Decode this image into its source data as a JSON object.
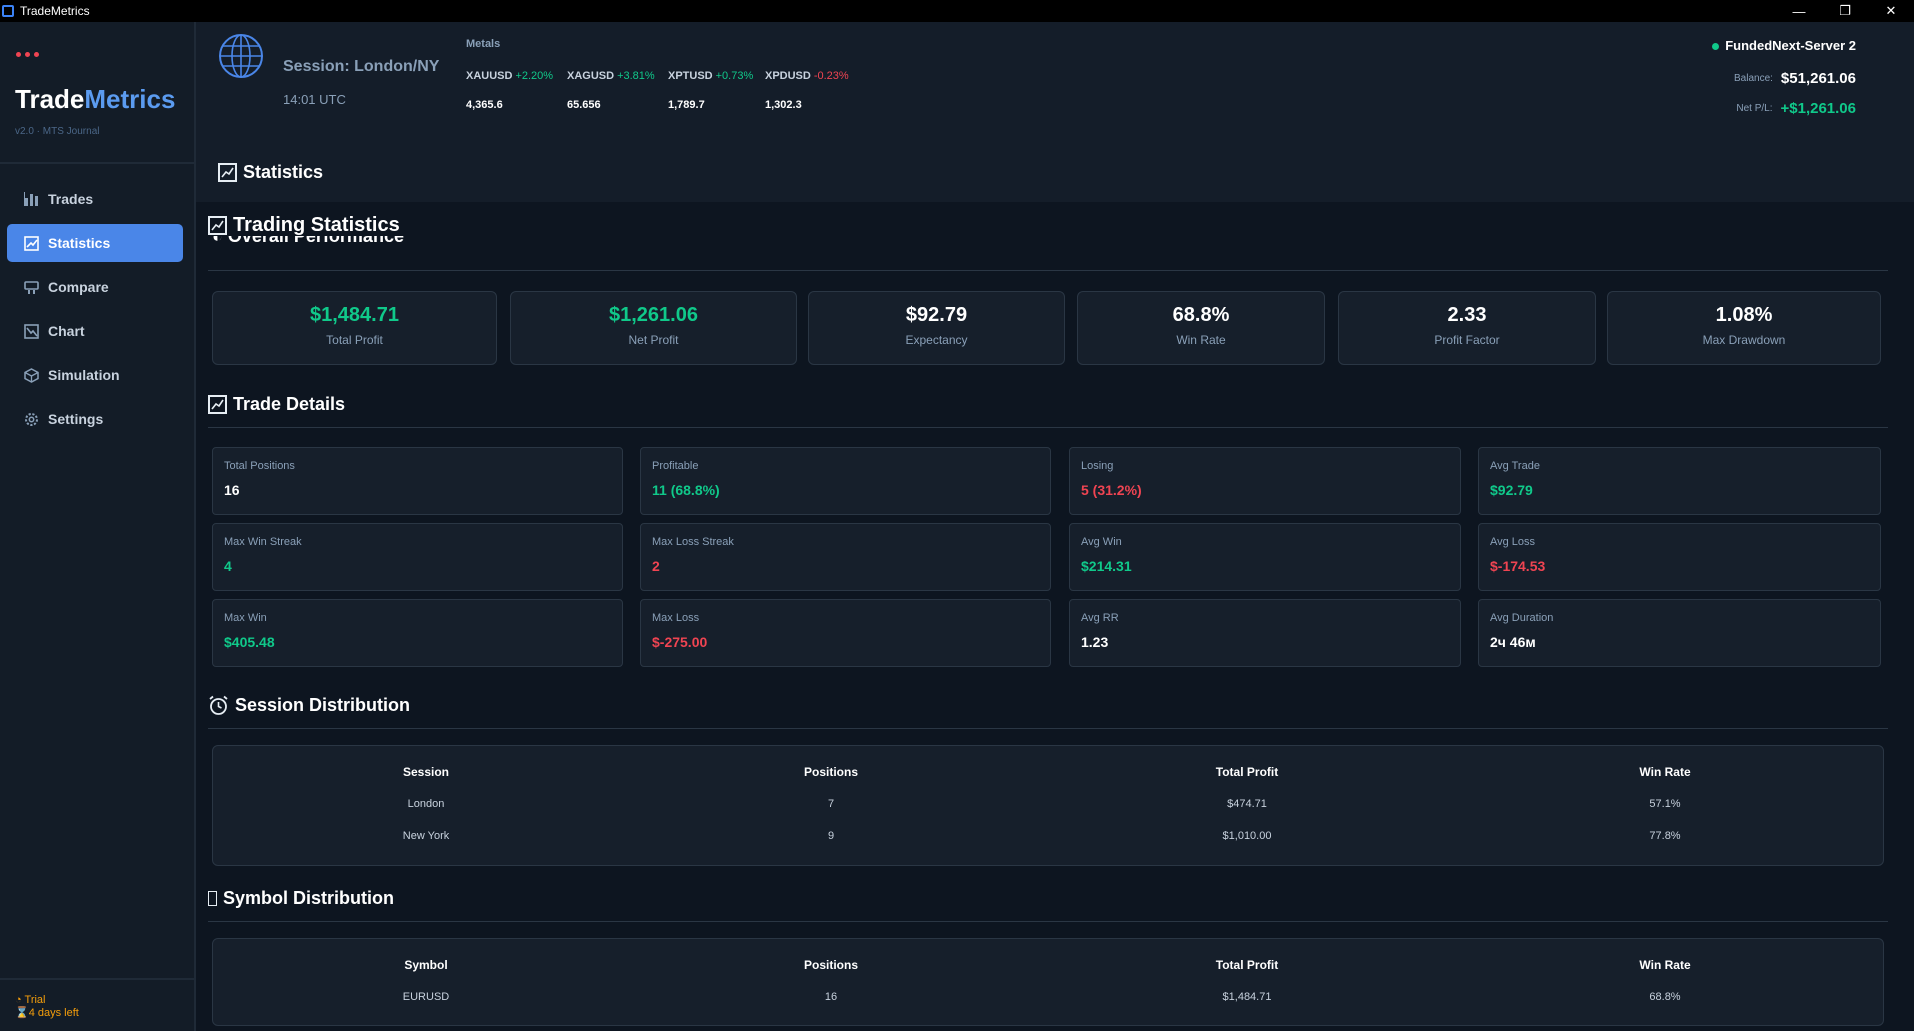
{
  "window": {
    "title": "TradeMetrics",
    "min": "—",
    "restore": "❐",
    "close": "✕"
  },
  "sidebar": {
    "brand_part1": "Trade",
    "brand_part2": "Metrics",
    "version": "v2.0 · MTS Journal",
    "items": [
      {
        "label": "Trades",
        "icon": "bar-chart-icon"
      },
      {
        "label": "Statistics",
        "icon": "checkbox-chart-icon",
        "active": true
      },
      {
        "label": "Compare",
        "icon": "compare-icon"
      },
      {
        "label": "Chart",
        "icon": "line-chart-icon"
      },
      {
        "label": "Simulation",
        "icon": "cube-icon"
      },
      {
        "label": "Settings",
        "icon": "gear-icon"
      }
    ],
    "trial_label": "Trial",
    "trial_days": "4 days left"
  },
  "header": {
    "session": "Session: London/NY",
    "time": "14:01 UTC",
    "metals_label": "Metals",
    "metals": [
      {
        "symbol": "XAUUSD",
        "change": "+2.20%",
        "price": "4,365.6",
        "direction": "up"
      },
      {
        "symbol": "XAGUSD",
        "change": "+3.81%",
        "price": "65.656",
        "direction": "up"
      },
      {
        "symbol": "XPTUSD",
        "change": "+0.73%",
        "price": "1,789.7",
        "direction": "up"
      },
      {
        "symbol": "XPDUSD",
        "change": "-0.23%",
        "price": "1,302.3",
        "direction": "down"
      }
    ],
    "server": "FundedNext-Server 2",
    "balance_label": "Balance:",
    "balance": "$51,261.06",
    "netpl_label": "Net P/L:",
    "netpl": "+$1,261.06",
    "page_title": "Statistics"
  },
  "main": {
    "title": "Trading Statistics",
    "overall_title": "Overall Performance",
    "kpis": [
      {
        "value": "$1,484.71",
        "label": "Total Profit",
        "color": "green"
      },
      {
        "value": "$1,261.06",
        "label": "Net Profit",
        "color": "green"
      },
      {
        "value": "$92.79",
        "label": "Expectancy",
        "color": "white"
      },
      {
        "value": "68.8%",
        "label": "Win Rate",
        "color": "white"
      },
      {
        "value": "2.33",
        "label": "Profit Factor",
        "color": "white"
      },
      {
        "value": "1.08%",
        "label": "Max Drawdown",
        "color": "white"
      }
    ],
    "details_title": "Trade Details",
    "details": [
      {
        "label": "Total Positions",
        "value": "16",
        "color": "white"
      },
      {
        "label": "Profitable",
        "value": "11 (68.8%)",
        "color": "green"
      },
      {
        "label": "Losing",
        "value": "5 (31.2%)",
        "color": "red"
      },
      {
        "label": "Avg Trade",
        "value": "$92.79",
        "color": "green"
      },
      {
        "label": "Max Win Streak",
        "value": "4",
        "color": "green"
      },
      {
        "label": "Max Loss Streak",
        "value": "2",
        "color": "red"
      },
      {
        "label": "Avg Win",
        "value": "$214.31",
        "color": "green"
      },
      {
        "label": "Avg Loss",
        "value": "$-174.53",
        "color": "red"
      },
      {
        "label": "Max Win",
        "value": "$405.48",
        "color": "green"
      },
      {
        "label": "Max Loss",
        "value": "$-275.00",
        "color": "red"
      },
      {
        "label": "Avg RR",
        "value": "1.23",
        "color": "white"
      },
      {
        "label": "Avg Duration",
        "value": "2ч 46м",
        "color": "white"
      }
    ],
    "session_title": "Session Distribution",
    "session_headers": [
      "Session",
      "Positions",
      "Total Profit",
      "Win Rate"
    ],
    "session_rows": [
      [
        "London",
        "7",
        "$474.71",
        "57.1%"
      ],
      [
        "New York",
        "9",
        "$1,010.00",
        "77.8%"
      ]
    ],
    "symbol_title": "Symbol Distribution",
    "symbol_headers": [
      "Symbol",
      "Positions",
      "Total Profit",
      "Win Rate"
    ],
    "symbol_rows": [
      [
        "EURUSD",
        "16",
        "$1,484.71",
        "68.8%"
      ]
    ]
  },
  "colors": {
    "accent": "#4a86e8",
    "green": "#10c98a",
    "red": "#f04452",
    "bg": "#0d1520",
    "panel": "#161f2b"
  }
}
